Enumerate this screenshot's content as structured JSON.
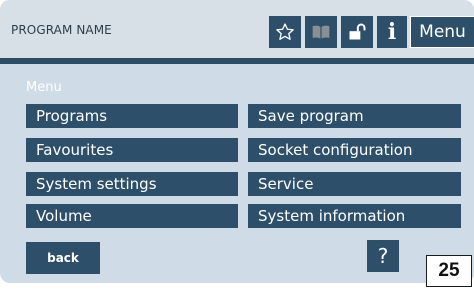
{
  "header": {
    "program_name": "PROGRAM NAME",
    "icons": [
      "star-icon",
      "book-icon",
      "unlock-icon",
      "info-icon"
    ],
    "info_label": "i",
    "menu_button": "Menu"
  },
  "menu": {
    "section_label": "Menu",
    "left_items": [
      "Programs",
      "Favourites",
      "System settings",
      "Volume"
    ],
    "right_items": [
      "Save program",
      "Socket configuration",
      "Service",
      "System information"
    ]
  },
  "footer": {
    "back_label": "back",
    "help_label": "?"
  },
  "page_number": "25",
  "colors": {
    "screen_bg": "#cfdbe6",
    "button_bg": "#2d4f6a",
    "header_line": "#2d4d66",
    "text_light": "#ffffff"
  }
}
